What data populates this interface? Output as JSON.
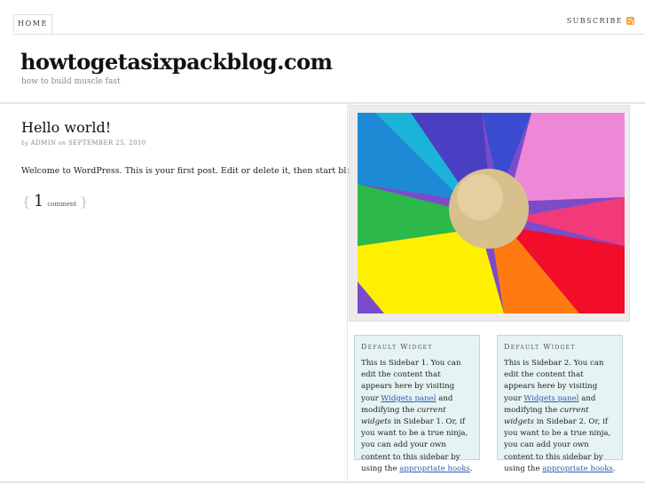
{
  "nav": {
    "home": "HOME",
    "subscribe": "SUBSCRIBE",
    "rss_icon": "rss-icon"
  },
  "site": {
    "title": "howtogetasixpackblog.com",
    "tagline": "how to build muscle fast"
  },
  "post": {
    "title": "Hello world!",
    "by": "by",
    "author": "ADMIN",
    "on": "on",
    "date": "SEPTEMBER 25, 2010",
    "body": "Welcome to WordPress. This is your first post. Edit or delete it, then start blogging!",
    "comment_open": "{",
    "comment_count": "1",
    "comment_label": "comment",
    "comment_close": "}"
  },
  "sidebar": {
    "image_alt": "colorful pinwheel with wooden ball",
    "widgets": [
      {
        "title": "Default Widget",
        "text_1": "This is Sidebar 1. You can edit the content that appears here by visiting your ",
        "link_1": "Widgets panel",
        "text_2": " and modifying the ",
        "em": "current widgets",
        "text_3": " in Sidebar 1. Or, if you want to be a true ninja, you can add your own content to this sidebar by using the ",
        "link_2": "appropriate hooks",
        "text_4": "."
      },
      {
        "title": "Default Widget",
        "text_1": "This is Sidebar 2. You can edit the content that appears here by visiting your ",
        "link_1": "Widgets panel",
        "text_2": " and modifying the ",
        "em": "current widgets",
        "text_3": " in Sidebar 2. Or, if you want to be a true ninja, you can add your own content to this sidebar by using the ",
        "link_2": "appropriate hooks",
        "text_4": "."
      }
    ]
  }
}
